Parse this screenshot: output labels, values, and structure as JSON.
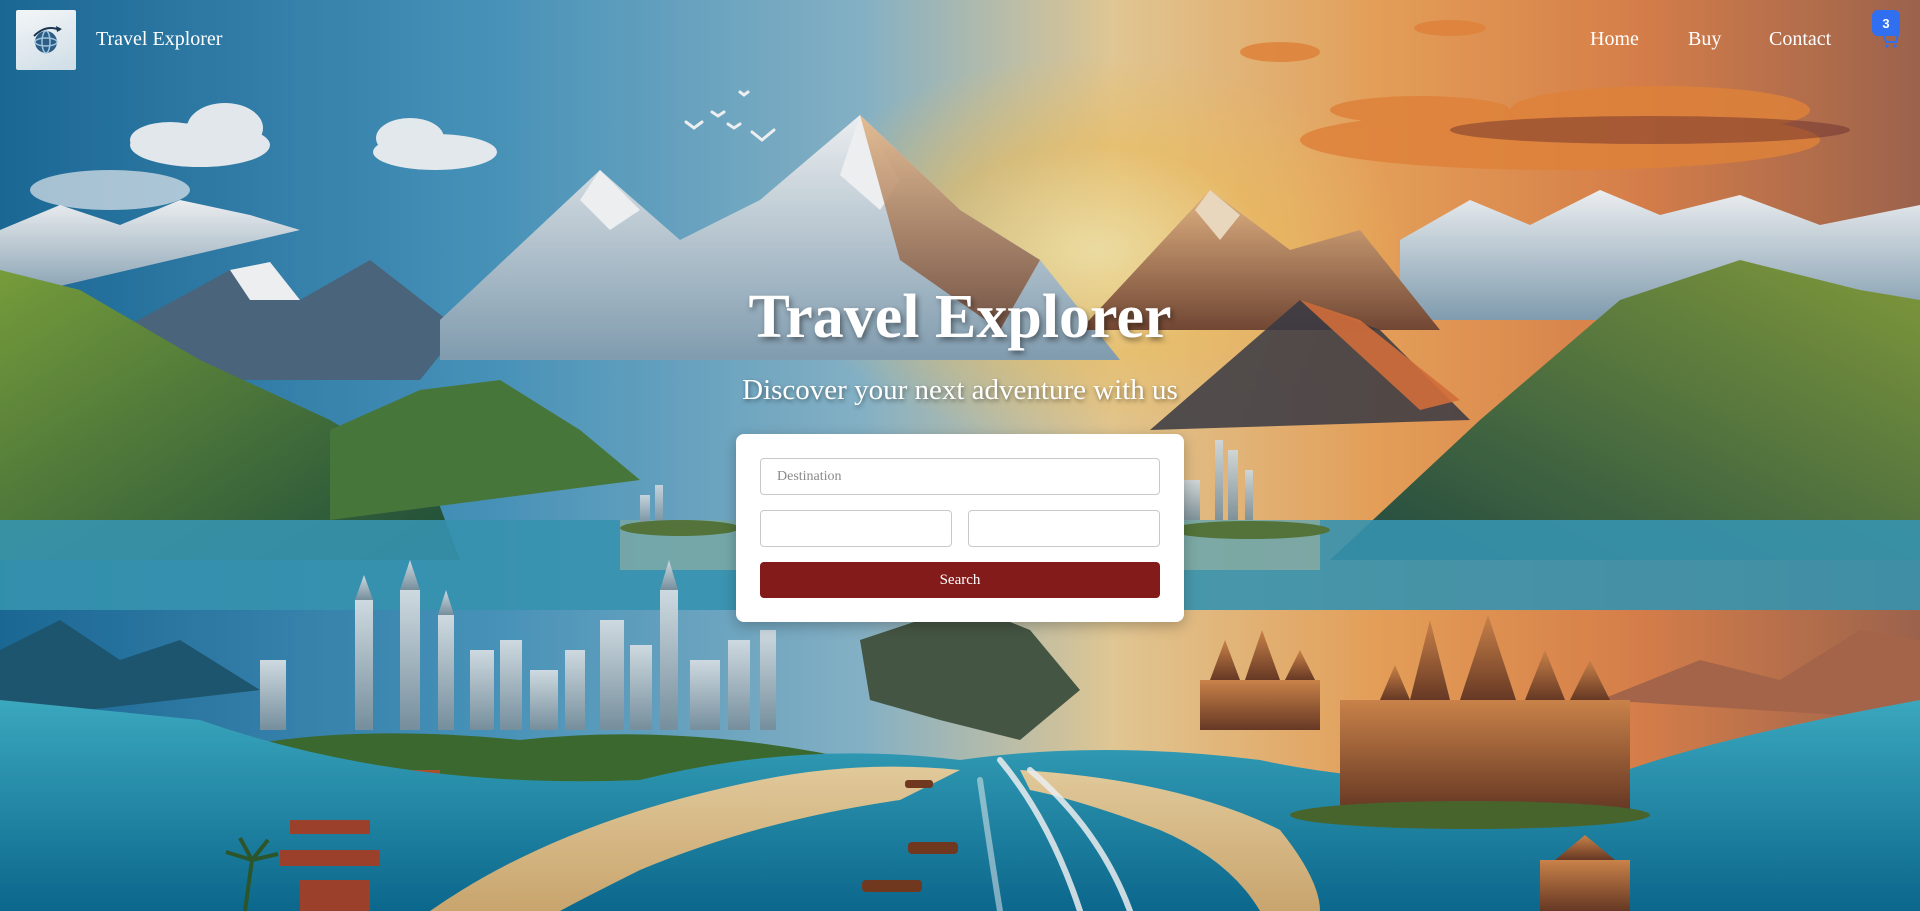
{
  "header": {
    "brand": "Travel Explorer",
    "logo_icon": "globe-airplane-icon",
    "nav": [
      {
        "label": "Home"
      },
      {
        "label": "Buy"
      },
      {
        "label": "Contact"
      }
    ],
    "cart": {
      "icon": "cart-icon",
      "count": "3",
      "badge_color": "#2f6ff0"
    }
  },
  "hero": {
    "title": "Travel Explorer",
    "subtitle": "Discover your next adventure with us"
  },
  "search": {
    "destination_placeholder": "Destination",
    "destination_value": "",
    "date_from_value": "",
    "date_to_value": "",
    "button_label": "Search",
    "button_color": "#841b1b"
  }
}
